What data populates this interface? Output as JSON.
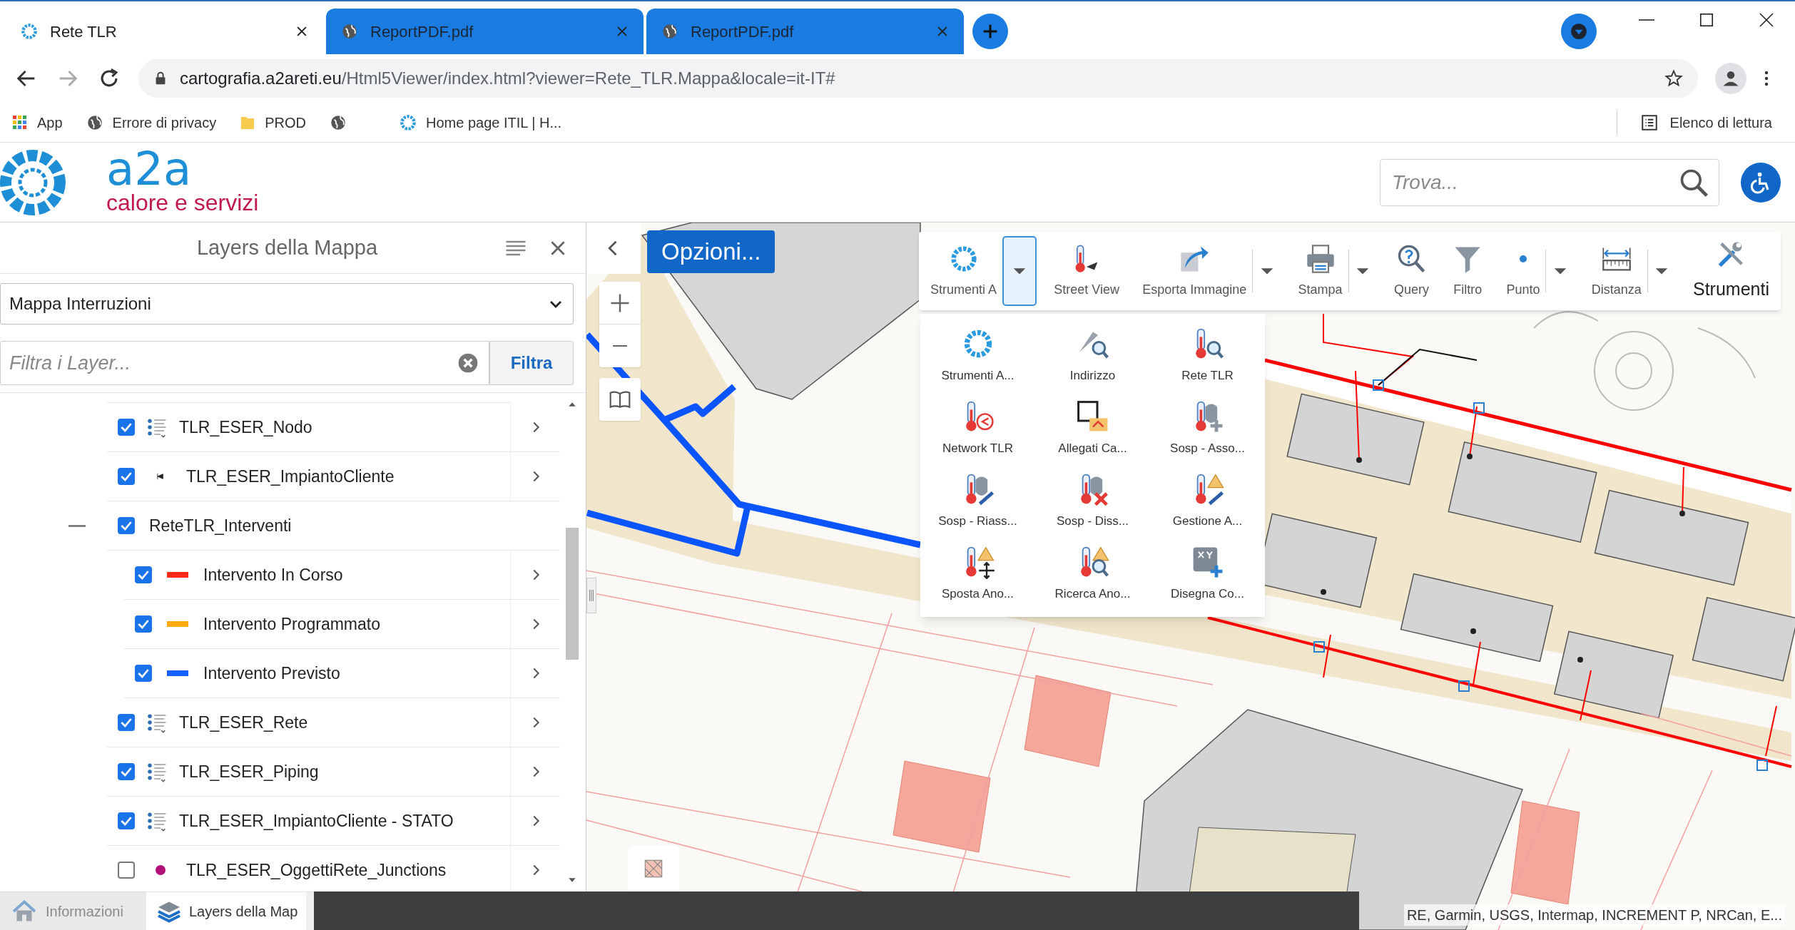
{
  "browser": {
    "tabs": [
      {
        "title": "Rete TLR",
        "selected": true
      },
      {
        "title": "ReportPDF.pdf",
        "selected": false
      },
      {
        "title": "ReportPDF.pdf",
        "selected": false
      }
    ],
    "address": {
      "host": "cartografia.a2areti.eu",
      "path": "/Html5Viewer/index.html?viewer=Rete_TLR.Mappa&locale=it-IT#"
    },
    "bookmarks": [
      {
        "label": "App",
        "kind": "apps"
      },
      {
        "label": "Errore di privacy",
        "kind": "globe"
      },
      {
        "label": "PROD",
        "kind": "folder"
      },
      {
        "kind": "globe"
      },
      {
        "label": "Home page ITIL | H...",
        "kind": "ring"
      }
    ],
    "reading_list": "Elenco di lettura"
  },
  "header": {
    "logo": {
      "name": "a2a",
      "tagline": "calore e servizi"
    },
    "search": {
      "placeholder": "Trova..."
    }
  },
  "layers_panel": {
    "title": "Layers della Mappa",
    "map_select": "Mappa Interruzioni",
    "filter": {
      "placeholder": "Filtra i Layer..."
    },
    "filter_button": "Filtra",
    "layers": [
      {
        "label": "TLR_ESER_Nodo",
        "checked": true,
        "kind": "group"
      },
      {
        "label": "TLR_ESER_ImpiantoCliente",
        "checked": true,
        "kind": "point"
      },
      {
        "label": "ReteTLR_Interventi",
        "checked": true,
        "kind": "folder",
        "expanded": true,
        "children": [
          {
            "label": "Intervento In Corso",
            "checked": true,
            "kind": "line",
            "color": "#ff2a1a"
          },
          {
            "label": "Intervento Programmato",
            "checked": true,
            "kind": "line",
            "color": "#ffaa10"
          },
          {
            "label": "Intervento Previsto",
            "checked": true,
            "kind": "line",
            "color": "#1560ff"
          }
        ]
      },
      {
        "label": "TLR_ESER_Rete",
        "checked": true,
        "kind": "group"
      },
      {
        "label": "TLR_ESER_Piping",
        "checked": true,
        "kind": "group"
      },
      {
        "label": "TLR_ESER_ImpiantoCliente - STATO",
        "checked": true,
        "kind": "group"
      },
      {
        "label": "TLR_ESER_OggettiRete_Junctions",
        "checked": false,
        "kind": "dot",
        "color": "#b0127a"
      }
    ]
  },
  "bottom_tabs": [
    {
      "label": "Informazioni",
      "selected": false
    },
    {
      "label": "Layers della Map",
      "selected": true
    }
  ],
  "map": {
    "options_button": "Opzioni...",
    "attribution": "RE, Garmin, USGS, Intermap, INCREMENT P, NRCan, E..."
  },
  "toolbar": {
    "items": [
      {
        "label": "Strumenti A",
        "kind": "split",
        "expanded": true
      },
      {
        "label": "Street View",
        "kind": "button"
      },
      {
        "label": "Esporta Immagine",
        "kind": "split",
        "expanded": false
      },
      {
        "label": "Stampa",
        "kind": "split",
        "expanded": false
      },
      {
        "label": "Query",
        "kind": "button"
      },
      {
        "label": "Filtro",
        "kind": "button"
      },
      {
        "label": "Punto",
        "kind": "split",
        "expanded": false
      },
      {
        "label": "Distanza",
        "kind": "split",
        "expanded": false
      },
      {
        "label": "Strumenti",
        "kind": "large"
      }
    ]
  },
  "tools_menu": {
    "items": [
      {
        "label": "Strumenti A..."
      },
      {
        "label": "Indirizzo"
      },
      {
        "label": "Rete TLR"
      },
      {
        "label": "Network TLR"
      },
      {
        "label": "Allegati Ca..."
      },
      {
        "label": "Sosp - Asso..."
      },
      {
        "label": "Sosp - Riass..."
      },
      {
        "label": "Sosp - Diss..."
      },
      {
        "label": "Gestione A..."
      },
      {
        "label": "Sposta Ano..."
      },
      {
        "label": "Ricerca Ano..."
      },
      {
        "label": "Disegna Co..."
      }
    ]
  }
}
